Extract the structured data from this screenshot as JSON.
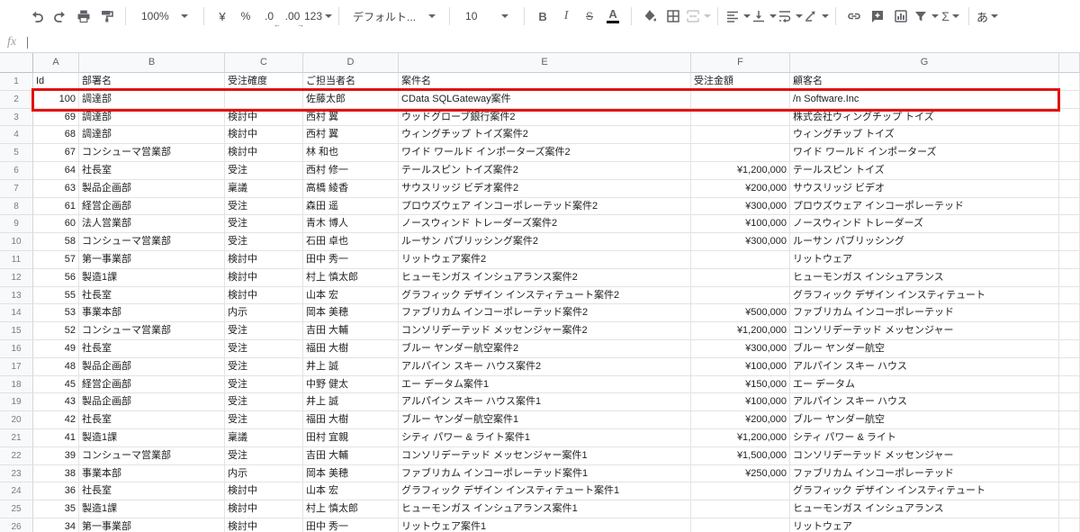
{
  "toolbar": {
    "zoom_label": "100%",
    "currency_label": "¥",
    "percent_label": "%",
    "decrease_decimal_label": ".0",
    "increase_decimal_label": ".00",
    "decrease_decimal_arrow": "←",
    "increase_decimal_arrow": "→",
    "number_format_label": "123",
    "font_family_value": "デフォルト...",
    "font_size_value": "10",
    "bold_label": "B",
    "italic_label": "I",
    "strikethrough_label": "S",
    "text_color_label": "A",
    "functions_label": "Σ",
    "input_tools_label": "あ"
  },
  "formula_bar": {
    "fx_label": "fx",
    "input_value": ""
  },
  "colors": {
    "highlight_border": "#e31212",
    "icon_gray": "#5f6368",
    "header_bg": "#f8f9fa"
  },
  "grid": {
    "column_letters": [
      "A",
      "B",
      "C",
      "D",
      "E",
      "F",
      "G",
      ""
    ],
    "rows": [
      {
        "n": "1",
        "header_row": true,
        "cells": [
          "Id",
          "部署名",
          "受注確度",
          "ご担当者名",
          "案件名",
          "受注金額",
          "顧客名"
        ]
      },
      {
        "n": "2",
        "highlight": true,
        "cells": [
          "100",
          "調達部",
          "",
          "佐藤太郎",
          "CData SQLGateway案件",
          "",
          "/n Software.Inc"
        ]
      },
      {
        "n": "3",
        "cells": [
          "69",
          "調達部",
          "検討中",
          "西村 翼",
          "ウッドグローブ銀行案件2",
          "",
          "株式会社ウィングチップ トイズ"
        ]
      },
      {
        "n": "4",
        "cells": [
          "68",
          "調達部",
          "検討中",
          "西村 翼",
          "ウィングチップ トイズ案件2",
          "",
          "ウィングチップ トイズ"
        ]
      },
      {
        "n": "5",
        "cells": [
          "67",
          "コンシューマ営業部",
          "検討中",
          "林 和也",
          "ワイド ワールド インポーターズ案件2",
          "",
          "ワイド ワールド インポーターズ"
        ]
      },
      {
        "n": "6",
        "cells": [
          "64",
          "社長室",
          "受注",
          "西村 修一",
          "テールスピン トイズ案件2",
          "¥1,200,000",
          "テールスピン トイズ"
        ]
      },
      {
        "n": "7",
        "cells": [
          "63",
          "製品企画部",
          "稟議",
          "高橋 綾香",
          "サウスリッジ ビデオ案件2",
          "¥200,000",
          "サウスリッジ ビデオ"
        ]
      },
      {
        "n": "8",
        "cells": [
          "61",
          "経営企画部",
          "受注",
          "森田 遥",
          "プロウズウェア インコーポレーテッド案件2",
          "¥300,000",
          "プロウズウェア インコーポレーテッド"
        ]
      },
      {
        "n": "9",
        "cells": [
          "60",
          "法人営業部",
          "受注",
          "青木 博人",
          "ノースウィンド トレーダーズ案件2",
          "¥100,000",
          "ノースウィンド トレーダーズ"
        ]
      },
      {
        "n": "10",
        "cells": [
          "58",
          "コンシューマ営業部",
          "受注",
          "石田 卓也",
          "ルーサン パブリッシング案件2",
          "¥300,000",
          "ルーサン パブリッシング"
        ]
      },
      {
        "n": "11",
        "cells": [
          "57",
          "第一事業部",
          "検討中",
          "田中 秀一",
          "リットウェア案件2",
          "",
          "リットウェア"
        ]
      },
      {
        "n": "12",
        "cells": [
          "56",
          "製造1課",
          "検討中",
          "村上 慎太郎",
          "ヒューモンガス インシュアランス案件2",
          "",
          "ヒューモンガス インシュアランス"
        ]
      },
      {
        "n": "13",
        "cells": [
          "55",
          "社長室",
          "検討中",
          "山本 宏",
          "グラフィック デザイン インスティテュート案件2",
          "",
          "グラフィック デザイン インスティテュート"
        ]
      },
      {
        "n": "14",
        "cells": [
          "53",
          "事業本部",
          "内示",
          "岡本 美穂",
          "ファブリカム インコーポレーテッド案件2",
          "¥500,000",
          "ファブリカム インコーポレーテッド"
        ]
      },
      {
        "n": "15",
        "cells": [
          "52",
          "コンシューマ営業部",
          "受注",
          "吉田 大輔",
          "コンソリデーテッド メッセンジャー案件2",
          "¥1,200,000",
          "コンソリデーテッド メッセンジャー"
        ]
      },
      {
        "n": "16",
        "cells": [
          "49",
          "社長室",
          "受注",
          "福田 大樹",
          "ブルー ヤンダー航空案件2",
          "¥300,000",
          "ブルー ヤンダー航空"
        ]
      },
      {
        "n": "17",
        "cells": [
          "48",
          "製品企画部",
          "受注",
          "井上 誠",
          "アルパイン スキー ハウス案件2",
          "¥100,000",
          "アルパイン スキー ハウス"
        ]
      },
      {
        "n": "18",
        "cells": [
          "45",
          "経営企画部",
          "受注",
          "中野 健太",
          "エー データム案件1",
          "¥150,000",
          "エー データム"
        ]
      },
      {
        "n": "19",
        "cells": [
          "43",
          "製品企画部",
          "受注",
          "井上 誠",
          "アルパイン スキー ハウス案件1",
          "¥100,000",
          "アルパイン スキー ハウス"
        ]
      },
      {
        "n": "20",
        "cells": [
          "42",
          "社長室",
          "受注",
          "福田 大樹",
          "ブルー ヤンダー航空案件1",
          "¥200,000",
          "ブルー ヤンダー航空"
        ]
      },
      {
        "n": "21",
        "cells": [
          "41",
          "製造1課",
          "稟議",
          "田村 宜親",
          "シティ パワー & ライト案件1",
          "¥1,200,000",
          "シティ パワー & ライト"
        ]
      },
      {
        "n": "22",
        "cells": [
          "39",
          "コンシューマ営業部",
          "受注",
          "吉田 大輔",
          "コンソリデーテッド メッセンジャー案件1",
          "¥1,500,000",
          "コンソリデーテッド メッセンジャー"
        ]
      },
      {
        "n": "23",
        "cells": [
          "38",
          "事業本部",
          "内示",
          "岡本 美穂",
          "ファブリカム インコーポレーテッド案件1",
          "¥250,000",
          "ファブリカム インコーポレーテッド"
        ]
      },
      {
        "n": "24",
        "cells": [
          "36",
          "社長室",
          "検討中",
          "山本 宏",
          "グラフィック デザイン インスティテュート案件1",
          "",
          "グラフィック デザイン インスティテュート"
        ]
      },
      {
        "n": "25",
        "cells": [
          "35",
          "製造1課",
          "検討中",
          "村上 慎太郎",
          "ヒューモンガス インシュアランス案件1",
          "",
          "ヒューモンガス インシュアランス"
        ]
      },
      {
        "n": "26",
        "cells": [
          "34",
          "第一事業部",
          "検討中",
          "田中 秀一",
          "リットウェア案件1",
          "",
          "リットウェア"
        ]
      }
    ]
  }
}
